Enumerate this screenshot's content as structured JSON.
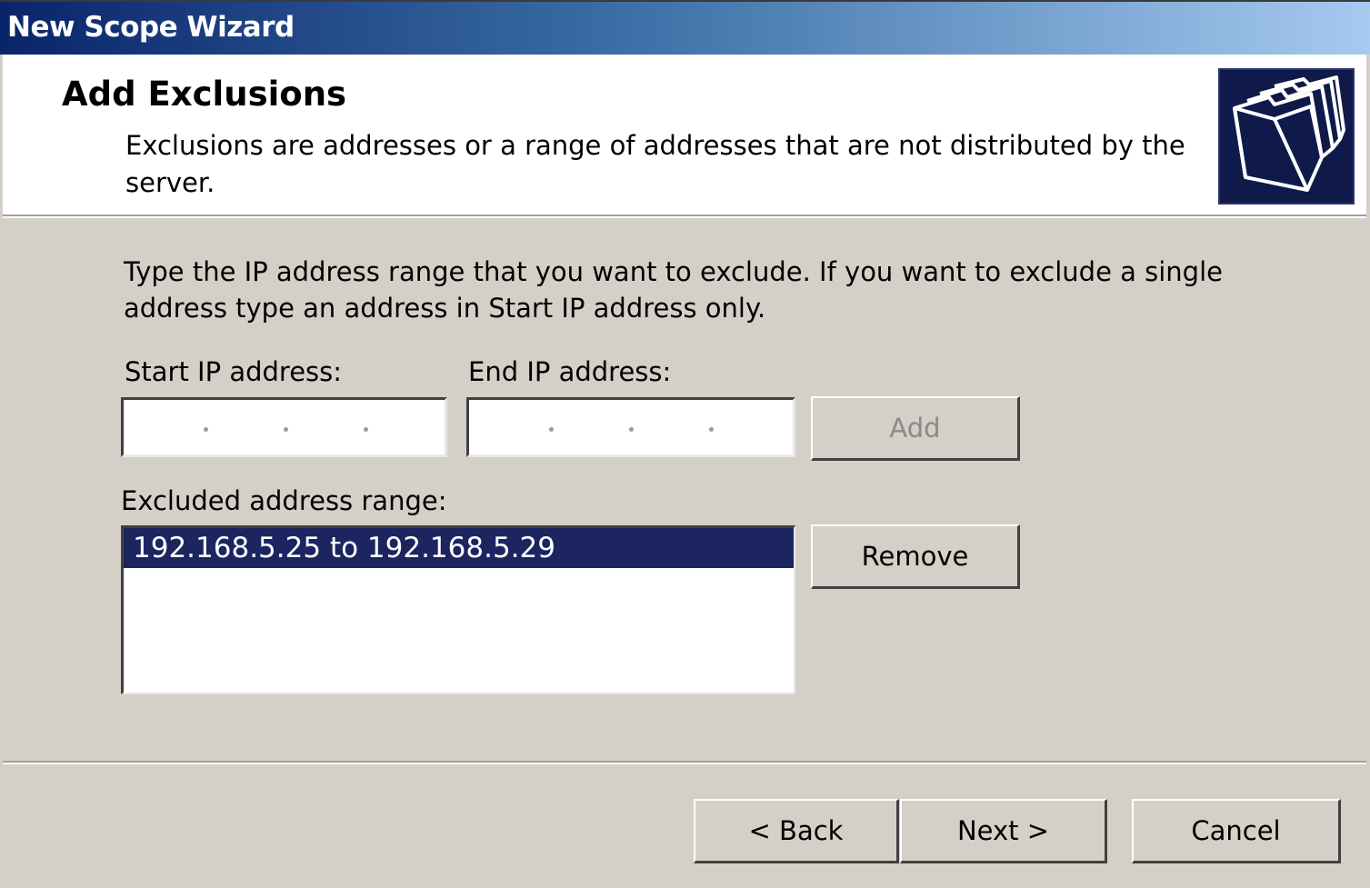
{
  "window": {
    "title": "New Scope Wizard"
  },
  "header": {
    "title": "Add Exclusions",
    "description": "Exclusions are addresses or a range of addresses that are not distributed by the server.",
    "icon": "folders-icon"
  },
  "instructions": "Type the IP address range that you want to exclude. If you want to exclude a single address type an address in Start IP address only.",
  "start_ip": {
    "label": "Start IP address:",
    "value": ""
  },
  "end_ip": {
    "label": "End IP address:",
    "value": ""
  },
  "add_button": {
    "label": "Add",
    "enabled": false
  },
  "excluded": {
    "label": "Excluded address range:",
    "items": [
      "192.168.5.25 to 192.168.5.29"
    ],
    "selected_index": 0
  },
  "remove_button": {
    "label": "Remove"
  },
  "footer": {
    "back_label": "< Back",
    "next_label": "Next >",
    "cancel_label": "Cancel"
  },
  "colors": {
    "dialog_bg": "#d4d0c8",
    "selection": "#1c2560",
    "title_gradient_start": "#0a246a",
    "title_gradient_end": "#a6caf0"
  }
}
